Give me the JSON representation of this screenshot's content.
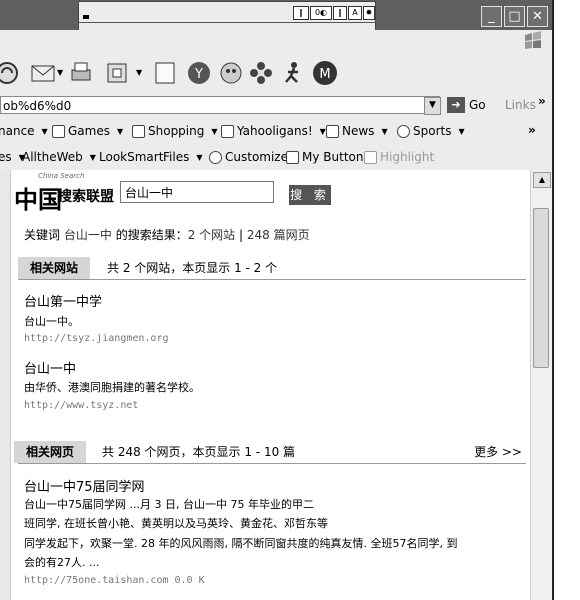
{
  "mini_toolbar": {
    "tray": [
      "❙",
      "0◐",
      "‖",
      "A",
      "✸"
    ]
  },
  "window": {
    "minimize": "_",
    "maximize": "□",
    "close": "✕"
  },
  "toolbar": {
    "icons": [
      "refresh-icon",
      "mail-icon",
      "print-icon",
      "edit-icon",
      "blank-icon",
      "yahoo-icon",
      "messenger-icon",
      "flower-icon",
      "runner-icon",
      "media-icon"
    ]
  },
  "address": {
    "value": "ob%d6%d0",
    "go_label": "Go",
    "links_label": "Links",
    "more": "»"
  },
  "yahoo_bar": {
    "items": [
      "nance",
      "Games",
      "Shopping",
      "Yahooligans!",
      "News",
      "Sports"
    ],
    "more": "»"
  },
  "yahoo_bar2": {
    "items": [
      "es",
      "AlltheWeb",
      "LookSmart",
      "Files",
      "Customize",
      "My Button",
      "Highlight"
    ]
  },
  "page": {
    "logo_text": "搜索联盟",
    "logo_sub": "China Search",
    "search_value": "台山一中",
    "search_button": "搜 索",
    "keyword_line": {
      "prefix": "关键词",
      "keyword": "台山一中",
      "middle": "的搜索结果：",
      "sites_count": "2 个网站",
      "sep": "|",
      "pages_count": "248 篇网页"
    },
    "sites_section": {
      "tab": "相关网站",
      "info": "共 2 个网站，本页显示 1 - 2 个"
    },
    "sites": [
      {
        "title": "台山第一中学",
        "desc": "台山一中。",
        "url": "http://tsyz.jiangmen.org"
      },
      {
        "title": "台山一中",
        "desc": "由华侨、港澳同胞捐建的著名学校。",
        "url": "http://www.tsyz.net"
      }
    ],
    "pages_section": {
      "tab": "相关网页",
      "info": "共 248 个网页，本页显示 1 - 10 篇",
      "more": "更多 >>"
    },
    "pages": [
      {
        "title": "台山一中75届同学网",
        "lines": [
          "台山一中75届同学网 ...月 3 日, 台山一中 75 年毕业的甲二",
          "班同学, 在班长曾小艳、黄英明以及马英玲、黄金花、邓哲东等",
          "同学发起下，欢聚一堂. 28 年的风风雨雨, 隔不断同窗共度的纯真友情. 全班57名同学, 到",
          "会的有27人. ..."
        ],
        "url": "http://75one.taishan.com  0.0 K"
      }
    ]
  }
}
